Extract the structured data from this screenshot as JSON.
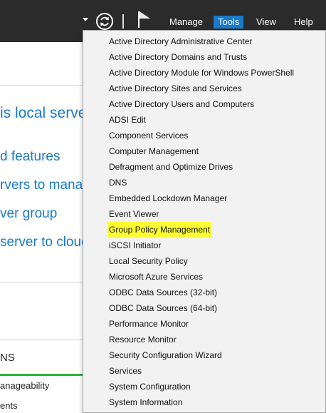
{
  "toolbar": {
    "menus": [
      "Manage",
      "Tools",
      "View",
      "Help"
    ],
    "active_menu": "Tools",
    "accent_color": "#1979ca",
    "icons": [
      "chevron-down-icon",
      "refresh-icon",
      "flag-icon"
    ]
  },
  "background_panel": {
    "title_fragment": "is local serve",
    "links": [
      "d features",
      "rvers to manag",
      "ver group",
      "server to clouc"
    ],
    "section_heading": "NS",
    "rows": [
      "anageability",
      "ents"
    ]
  },
  "tools_menu": {
    "highlight_color": "#ffff33",
    "highlighted_item": "Group Policy Management",
    "items": [
      "Active Directory Administrative Center",
      "Active Directory Domains and Trusts",
      "Active Directory Module for Windows PowerShell",
      "Active Directory Sites and Services",
      "Active Directory Users and Computers",
      "ADSI Edit",
      "Component Services",
      "Computer Management",
      "Defragment and Optimize Drives",
      "DNS",
      "Embedded Lockdown Manager",
      "Event Viewer",
      "Group Policy Management",
      "iSCSI Initiator",
      "Local Security Policy",
      "Microsoft Azure Services",
      "ODBC Data Sources (32-bit)",
      "ODBC Data Sources (64-bit)",
      "Performance Monitor",
      "Resource Monitor",
      "Security Configuration Wizard",
      "Services",
      "System Configuration",
      "System Information"
    ]
  }
}
